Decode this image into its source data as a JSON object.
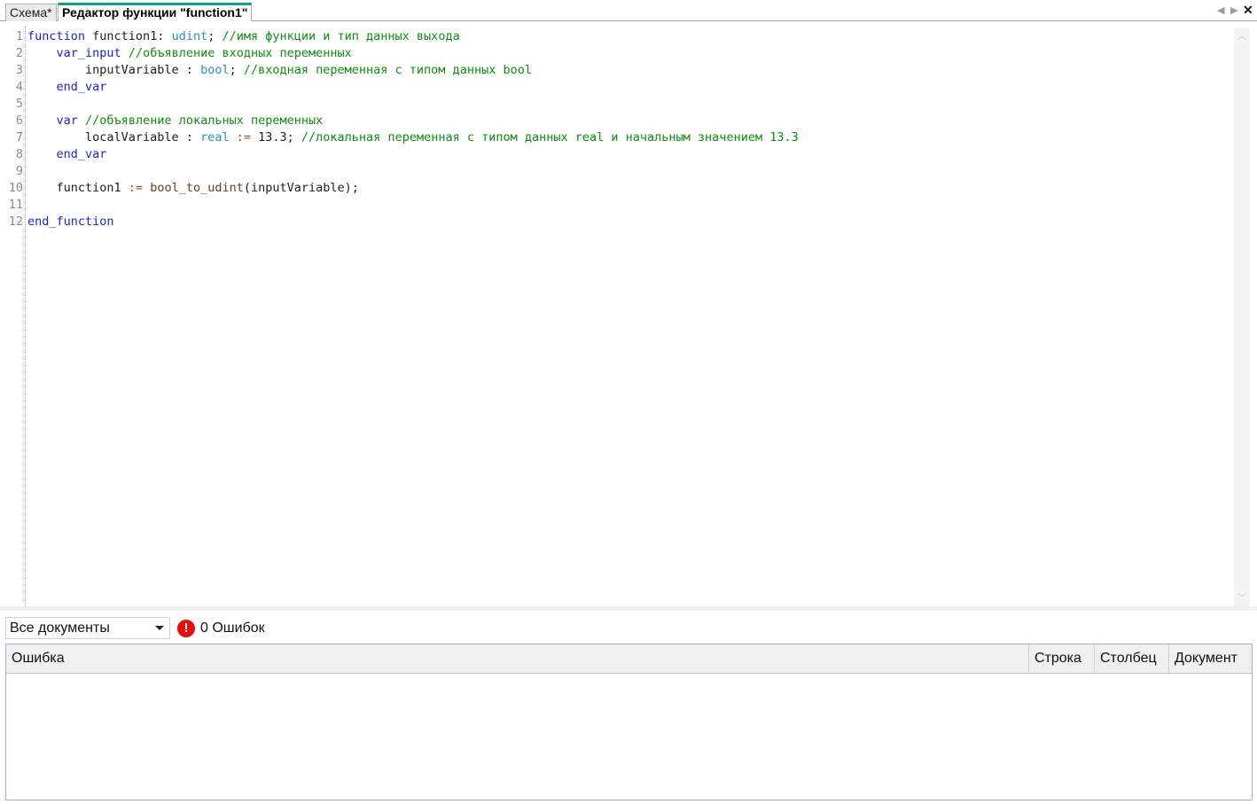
{
  "tabs": [
    {
      "label": "Схема*",
      "active": false
    },
    {
      "label": "Редактор функции \"function1\"",
      "active": true
    }
  ],
  "tab_controls": {
    "prev_icon": "◀",
    "next_icon": "▶",
    "close_icon": "✕"
  },
  "editor": {
    "line_numbers": [
      "1",
      "2",
      "3",
      "4",
      "5",
      "6",
      "7",
      "8",
      "9",
      "10",
      "11",
      "12"
    ],
    "lines": [
      [
        {
          "t": "kw",
          "v": "function"
        },
        {
          "t": "",
          "v": " function1: "
        },
        {
          "t": "ty",
          "v": "udint"
        },
        {
          "t": "",
          "v": "; "
        },
        {
          "t": "cm",
          "v": "//имя функции и тип данных выхода"
        }
      ],
      [
        {
          "t": "",
          "v": "    "
        },
        {
          "t": "kw",
          "v": "var_input"
        },
        {
          "t": "",
          "v": " "
        },
        {
          "t": "cm",
          "v": "//объявление входных переменных"
        }
      ],
      [
        {
          "t": "",
          "v": "        inputVariable : "
        },
        {
          "t": "ty",
          "v": "bool"
        },
        {
          "t": "",
          "v": "; "
        },
        {
          "t": "cm",
          "v": "//входная переменная с типом данных bool"
        }
      ],
      [
        {
          "t": "",
          "v": "    "
        },
        {
          "t": "kw",
          "v": "end_var"
        }
      ],
      [
        {
          "t": "",
          "v": ""
        }
      ],
      [
        {
          "t": "",
          "v": "    "
        },
        {
          "t": "kw",
          "v": "var"
        },
        {
          "t": "",
          "v": " "
        },
        {
          "t": "cm",
          "v": "//объявление локальных переменных"
        }
      ],
      [
        {
          "t": "",
          "v": "        localVariable : "
        },
        {
          "t": "ty",
          "v": "real"
        },
        {
          "t": "",
          "v": " "
        },
        {
          "t": "op",
          "v": ":="
        },
        {
          "t": "",
          "v": " 13.3; "
        },
        {
          "t": "cm",
          "v": "//локальная переменная с типом данных real и начальным значением 13.3"
        }
      ],
      [
        {
          "t": "",
          "v": "    "
        },
        {
          "t": "kw",
          "v": "end_var"
        }
      ],
      [
        {
          "t": "",
          "v": ""
        }
      ],
      [
        {
          "t": "",
          "v": "    function1 "
        },
        {
          "t": "op",
          "v": ":="
        },
        {
          "t": "",
          "v": " "
        },
        {
          "t": "fn",
          "v": "bool_to_udint"
        },
        {
          "t": "",
          "v": "(inputVariable);"
        }
      ],
      [
        {
          "t": "",
          "v": ""
        }
      ],
      [
        {
          "t": "kw",
          "v": "end_function"
        }
      ]
    ]
  },
  "scrollbar": {
    "up_icon": "︿",
    "down_icon": "﹀"
  },
  "errors_panel": {
    "filter_value": "Все документы",
    "error_icon": "!",
    "error_count_label": "0 Ошибок",
    "columns": [
      "Ошибка",
      "Строка",
      "Столбец",
      "Документ"
    ],
    "rows": []
  }
}
